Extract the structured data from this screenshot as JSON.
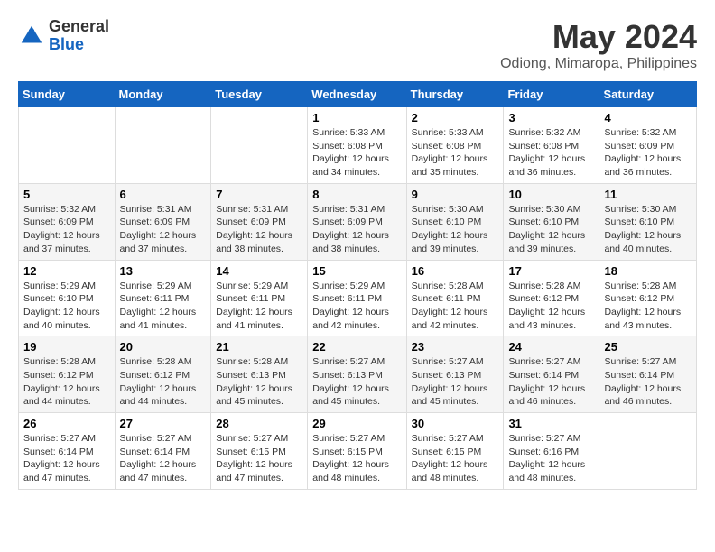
{
  "logo": {
    "general": "General",
    "blue": "Blue"
  },
  "title": "May 2024",
  "subtitle": "Odiong, Mimaropa, Philippines",
  "weekdays": [
    "Sunday",
    "Monday",
    "Tuesday",
    "Wednesday",
    "Thursday",
    "Friday",
    "Saturday"
  ],
  "weeks": [
    [
      {
        "day": "",
        "info": ""
      },
      {
        "day": "",
        "info": ""
      },
      {
        "day": "",
        "info": ""
      },
      {
        "day": "1",
        "info": "Sunrise: 5:33 AM\nSunset: 6:08 PM\nDaylight: 12 hours\nand 34 minutes."
      },
      {
        "day": "2",
        "info": "Sunrise: 5:33 AM\nSunset: 6:08 PM\nDaylight: 12 hours\nand 35 minutes."
      },
      {
        "day": "3",
        "info": "Sunrise: 5:32 AM\nSunset: 6:08 PM\nDaylight: 12 hours\nand 36 minutes."
      },
      {
        "day": "4",
        "info": "Sunrise: 5:32 AM\nSunset: 6:09 PM\nDaylight: 12 hours\nand 36 minutes."
      }
    ],
    [
      {
        "day": "5",
        "info": "Sunrise: 5:32 AM\nSunset: 6:09 PM\nDaylight: 12 hours\nand 37 minutes."
      },
      {
        "day": "6",
        "info": "Sunrise: 5:31 AM\nSunset: 6:09 PM\nDaylight: 12 hours\nand 37 minutes."
      },
      {
        "day": "7",
        "info": "Sunrise: 5:31 AM\nSunset: 6:09 PM\nDaylight: 12 hours\nand 38 minutes."
      },
      {
        "day": "8",
        "info": "Sunrise: 5:31 AM\nSunset: 6:09 PM\nDaylight: 12 hours\nand 38 minutes."
      },
      {
        "day": "9",
        "info": "Sunrise: 5:30 AM\nSunset: 6:10 PM\nDaylight: 12 hours\nand 39 minutes."
      },
      {
        "day": "10",
        "info": "Sunrise: 5:30 AM\nSunset: 6:10 PM\nDaylight: 12 hours\nand 39 minutes."
      },
      {
        "day": "11",
        "info": "Sunrise: 5:30 AM\nSunset: 6:10 PM\nDaylight: 12 hours\nand 40 minutes."
      }
    ],
    [
      {
        "day": "12",
        "info": "Sunrise: 5:29 AM\nSunset: 6:10 PM\nDaylight: 12 hours\nand 40 minutes."
      },
      {
        "day": "13",
        "info": "Sunrise: 5:29 AM\nSunset: 6:11 PM\nDaylight: 12 hours\nand 41 minutes."
      },
      {
        "day": "14",
        "info": "Sunrise: 5:29 AM\nSunset: 6:11 PM\nDaylight: 12 hours\nand 41 minutes."
      },
      {
        "day": "15",
        "info": "Sunrise: 5:29 AM\nSunset: 6:11 PM\nDaylight: 12 hours\nand 42 minutes."
      },
      {
        "day": "16",
        "info": "Sunrise: 5:28 AM\nSunset: 6:11 PM\nDaylight: 12 hours\nand 42 minutes."
      },
      {
        "day": "17",
        "info": "Sunrise: 5:28 AM\nSunset: 6:12 PM\nDaylight: 12 hours\nand 43 minutes."
      },
      {
        "day": "18",
        "info": "Sunrise: 5:28 AM\nSunset: 6:12 PM\nDaylight: 12 hours\nand 43 minutes."
      }
    ],
    [
      {
        "day": "19",
        "info": "Sunrise: 5:28 AM\nSunset: 6:12 PM\nDaylight: 12 hours\nand 44 minutes."
      },
      {
        "day": "20",
        "info": "Sunrise: 5:28 AM\nSunset: 6:12 PM\nDaylight: 12 hours\nand 44 minutes."
      },
      {
        "day": "21",
        "info": "Sunrise: 5:28 AM\nSunset: 6:13 PM\nDaylight: 12 hours\nand 45 minutes."
      },
      {
        "day": "22",
        "info": "Sunrise: 5:27 AM\nSunset: 6:13 PM\nDaylight: 12 hours\nand 45 minutes."
      },
      {
        "day": "23",
        "info": "Sunrise: 5:27 AM\nSunset: 6:13 PM\nDaylight: 12 hours\nand 45 minutes."
      },
      {
        "day": "24",
        "info": "Sunrise: 5:27 AM\nSunset: 6:14 PM\nDaylight: 12 hours\nand 46 minutes."
      },
      {
        "day": "25",
        "info": "Sunrise: 5:27 AM\nSunset: 6:14 PM\nDaylight: 12 hours\nand 46 minutes."
      }
    ],
    [
      {
        "day": "26",
        "info": "Sunrise: 5:27 AM\nSunset: 6:14 PM\nDaylight: 12 hours\nand 47 minutes."
      },
      {
        "day": "27",
        "info": "Sunrise: 5:27 AM\nSunset: 6:14 PM\nDaylight: 12 hours\nand 47 minutes."
      },
      {
        "day": "28",
        "info": "Sunrise: 5:27 AM\nSunset: 6:15 PM\nDaylight: 12 hours\nand 47 minutes."
      },
      {
        "day": "29",
        "info": "Sunrise: 5:27 AM\nSunset: 6:15 PM\nDaylight: 12 hours\nand 48 minutes."
      },
      {
        "day": "30",
        "info": "Sunrise: 5:27 AM\nSunset: 6:15 PM\nDaylight: 12 hours\nand 48 minutes."
      },
      {
        "day": "31",
        "info": "Sunrise: 5:27 AM\nSunset: 6:16 PM\nDaylight: 12 hours\nand 48 minutes."
      },
      {
        "day": "",
        "info": ""
      }
    ]
  ]
}
